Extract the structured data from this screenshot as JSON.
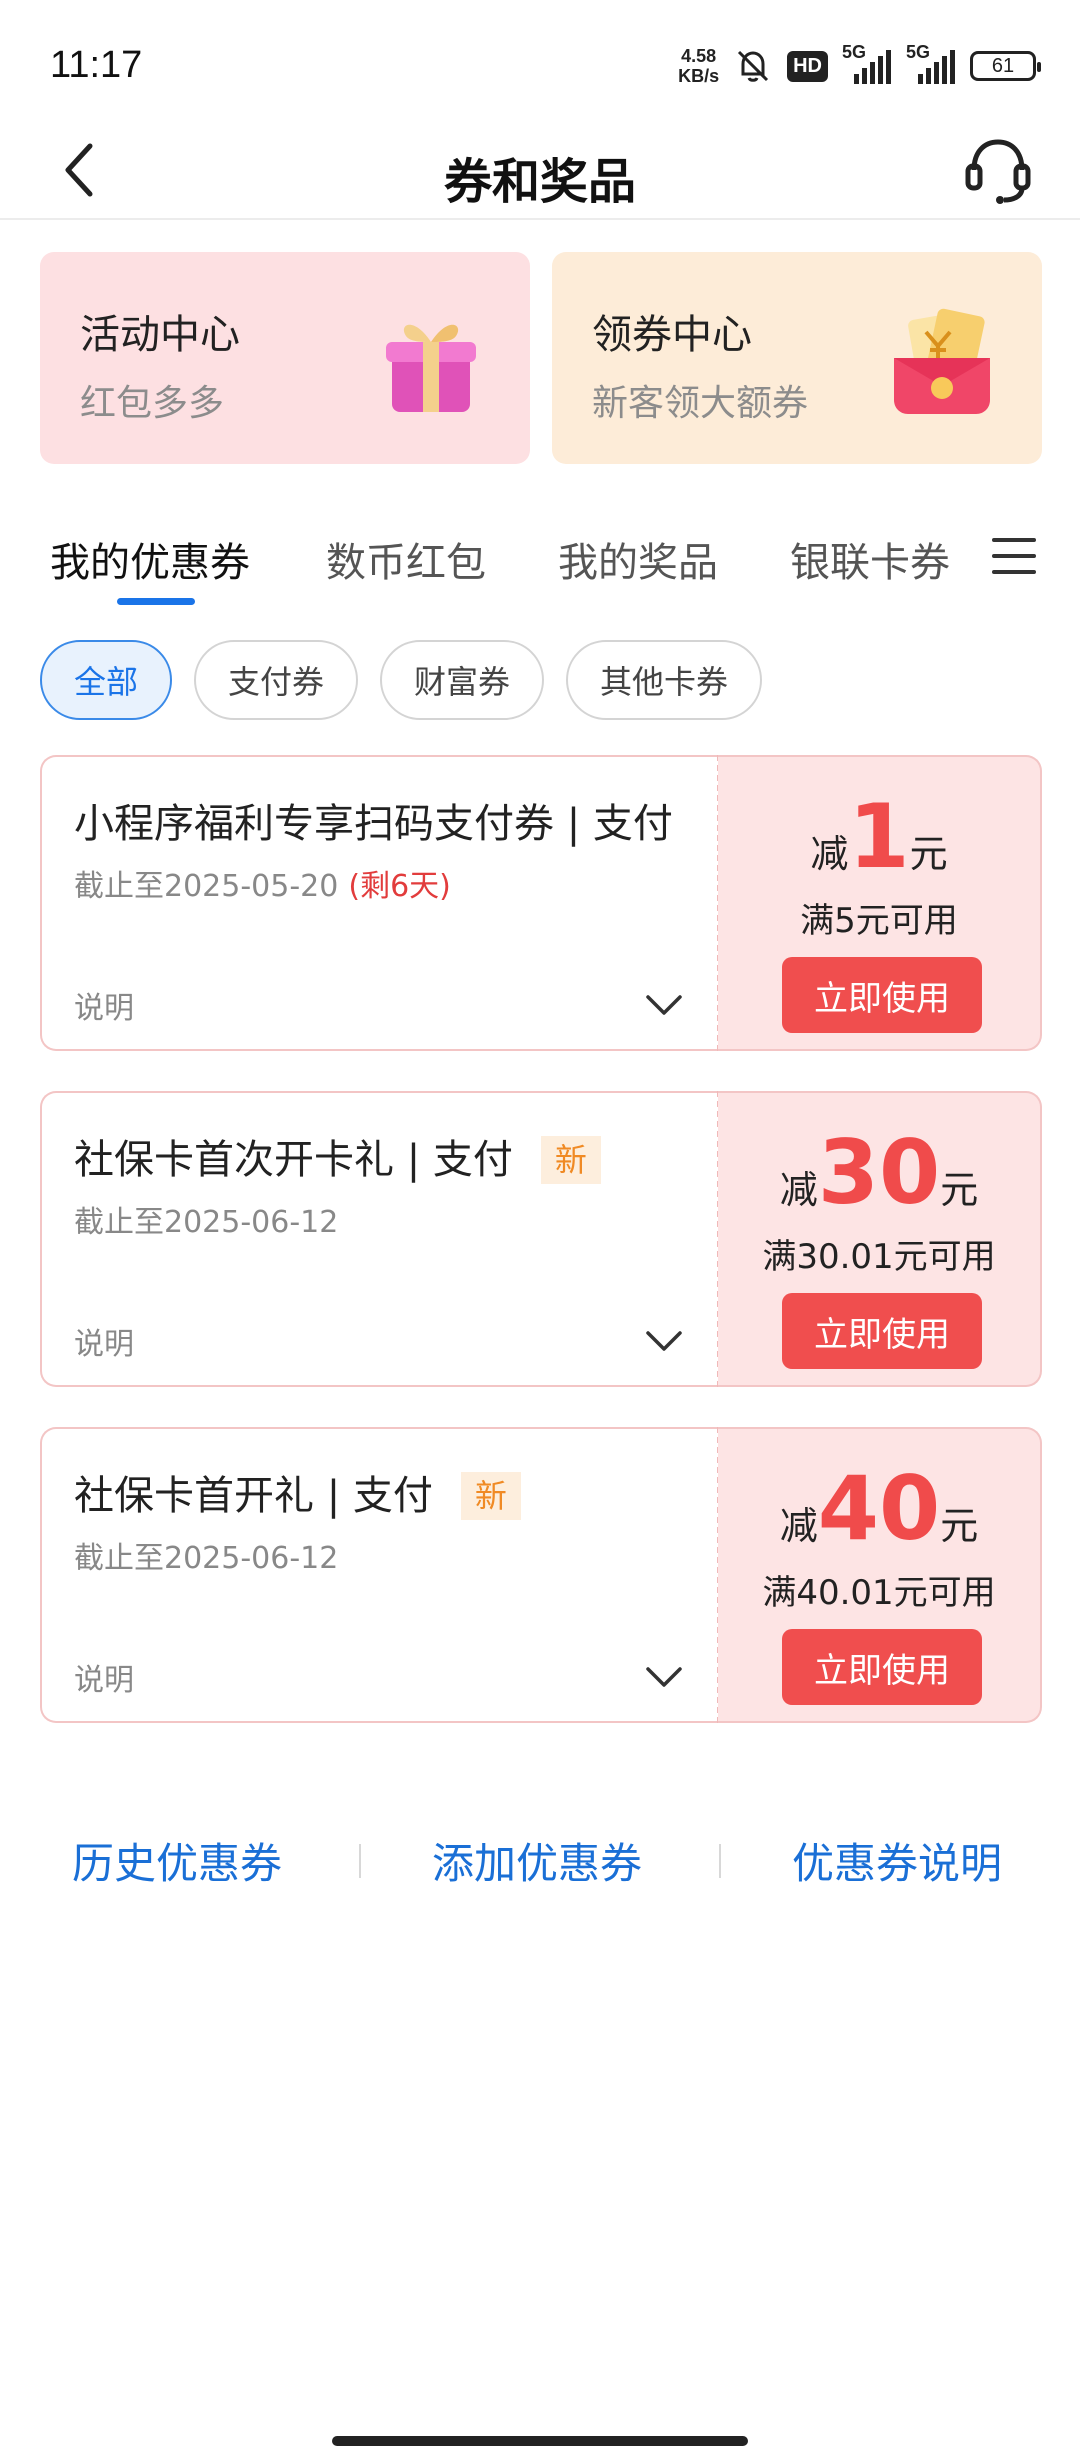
{
  "status_bar": {
    "time": "11:17",
    "net_speed_value": "4.58",
    "net_speed_unit": "KB/s",
    "hd_label": "HD",
    "sim1_gen": "5G",
    "sim2_gen": "5G",
    "battery": "61"
  },
  "header": {
    "title": "券和奖品",
    "back_icon": "chevron-left-icon",
    "service_icon": "headset-icon"
  },
  "promos": [
    {
      "title": "活动中心",
      "subtitle": "红包多多",
      "icon": "gift-box-icon"
    },
    {
      "title": "领券中心",
      "subtitle": "新客领大额券",
      "icon": "red-envelope-icon"
    }
  ],
  "tabs": [
    {
      "label": "我的优惠券",
      "active": true
    },
    {
      "label": "数币红包",
      "active": false
    },
    {
      "label": "我的奖品",
      "active": false
    },
    {
      "label": "银联卡券",
      "active": false
    }
  ],
  "filters": [
    {
      "label": "全部",
      "active": true
    },
    {
      "label": "支付券",
      "active": false
    },
    {
      "label": "财富券",
      "active": false
    },
    {
      "label": "其他卡券",
      "active": false
    }
  ],
  "coupons": [
    {
      "title": "小程序福利专享扫码支付券 | 支付",
      "badge": "",
      "date": "截止至2025-05-20",
      "remaining": "(剩6天)",
      "desc": "说明",
      "prefix": "减",
      "amount": "1",
      "unit": "元",
      "condition": "满5元可用",
      "button": "立即使用"
    },
    {
      "title": "社保卡首次开卡礼 | 支付",
      "badge": "新",
      "date": "截止至2025-06-12",
      "remaining": "",
      "desc": "说明",
      "prefix": "减",
      "amount": "30",
      "unit": "元",
      "condition": "满30.01元可用",
      "button": "立即使用"
    },
    {
      "title": "社保卡首开礼 | 支付",
      "badge": "新",
      "date": "截止至2025-06-12",
      "remaining": "",
      "desc": "说明",
      "prefix": "减",
      "amount": "40",
      "unit": "元",
      "condition": "满40.01元可用",
      "button": "立即使用"
    }
  ],
  "bottom_links": [
    "历史优惠券",
    "添加优惠券",
    "优惠券说明"
  ],
  "colors": {
    "accent_blue": "#1a74e8",
    "coupon_red": "#f04b4b",
    "coupon_bg": "#fde4e4",
    "promo_pink": "#fde0e2",
    "promo_peach": "#fdecd8",
    "badge_orange": "#f08a24"
  }
}
